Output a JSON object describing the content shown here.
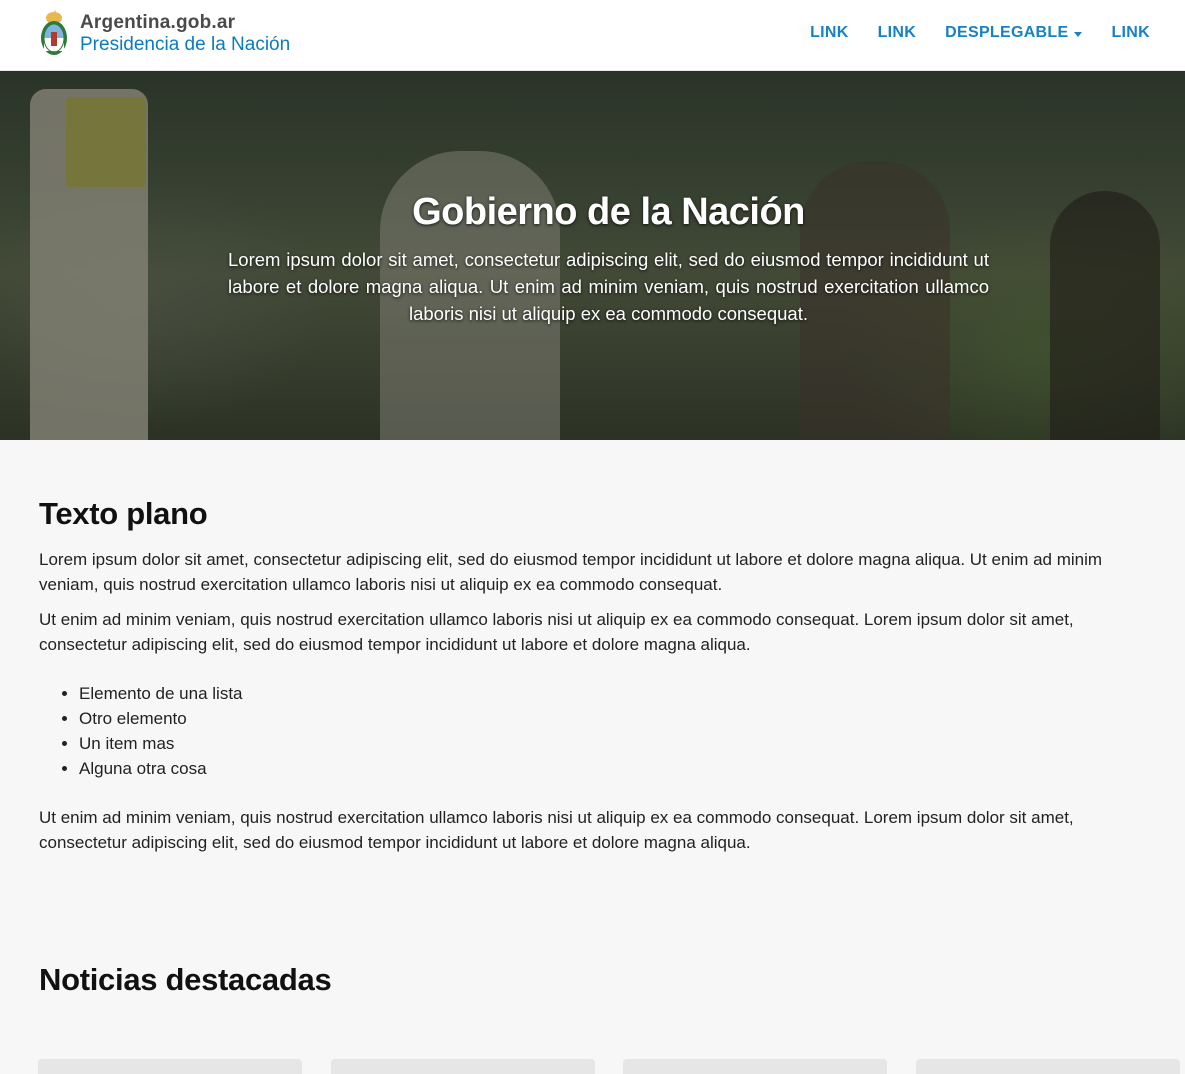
{
  "header": {
    "brand_line1": "Argentina.gob.ar",
    "brand_line2": "Presidencia de la Nación",
    "nav": [
      {
        "label": "LINK"
      },
      {
        "label": "LINK"
      },
      {
        "label": "DESPLEGABLE"
      },
      {
        "label": "LINK"
      }
    ]
  },
  "hero": {
    "title": "Gobierno de la Nación",
    "text": "Lorem ipsum dolor sit amet, consectetur adipiscing elit, sed do eiusmod tempor incididunt ut labore et dolore magna aliqua. Ut enim ad minim veniam, quis nostrud exercitation ullamco laboris nisi ut aliquip ex ea commodo consequat."
  },
  "main": {
    "texto_title": "Texto plano",
    "paragraph1": "Lorem ipsum dolor sit amet, consectetur adipiscing elit, sed do eiusmod tempor incididunt ut labore et dolore magna aliqua. Ut enim ad minim veniam, quis nostrud exercitation ullamco laboris nisi ut aliquip ex ea commodo consequat.",
    "paragraph2": "Ut enim ad minim veniam, quis nostrud exercitation ullamco laboris nisi ut aliquip ex ea commodo consequat. Lorem ipsum dolor sit amet, consectetur adipiscing elit, sed do eiusmod tempor incididunt ut labore et dolore magna aliqua.",
    "list": [
      "Elemento de una lista",
      "Otro elemento",
      "Un item mas",
      "Alguna otra cosa"
    ],
    "paragraph3": "Ut enim ad minim veniam, quis nostrud exercitation ullamco laboris nisi ut aliquip ex ea commodo consequat. Lorem ipsum dolor sit amet, consectetur adipiscing elit, sed do eiusmod tempor incididunt ut labore et dolore magna aliqua.",
    "news_title": "Noticias destacadas"
  },
  "colors": {
    "accent": "#1781c6",
    "brand_blue": "#0b7bc1",
    "page_bg": "#f7f7f7"
  },
  "icons": {
    "brand": "argentina-coat-of-arms-icon",
    "dropdown": "caret-down-icon"
  }
}
